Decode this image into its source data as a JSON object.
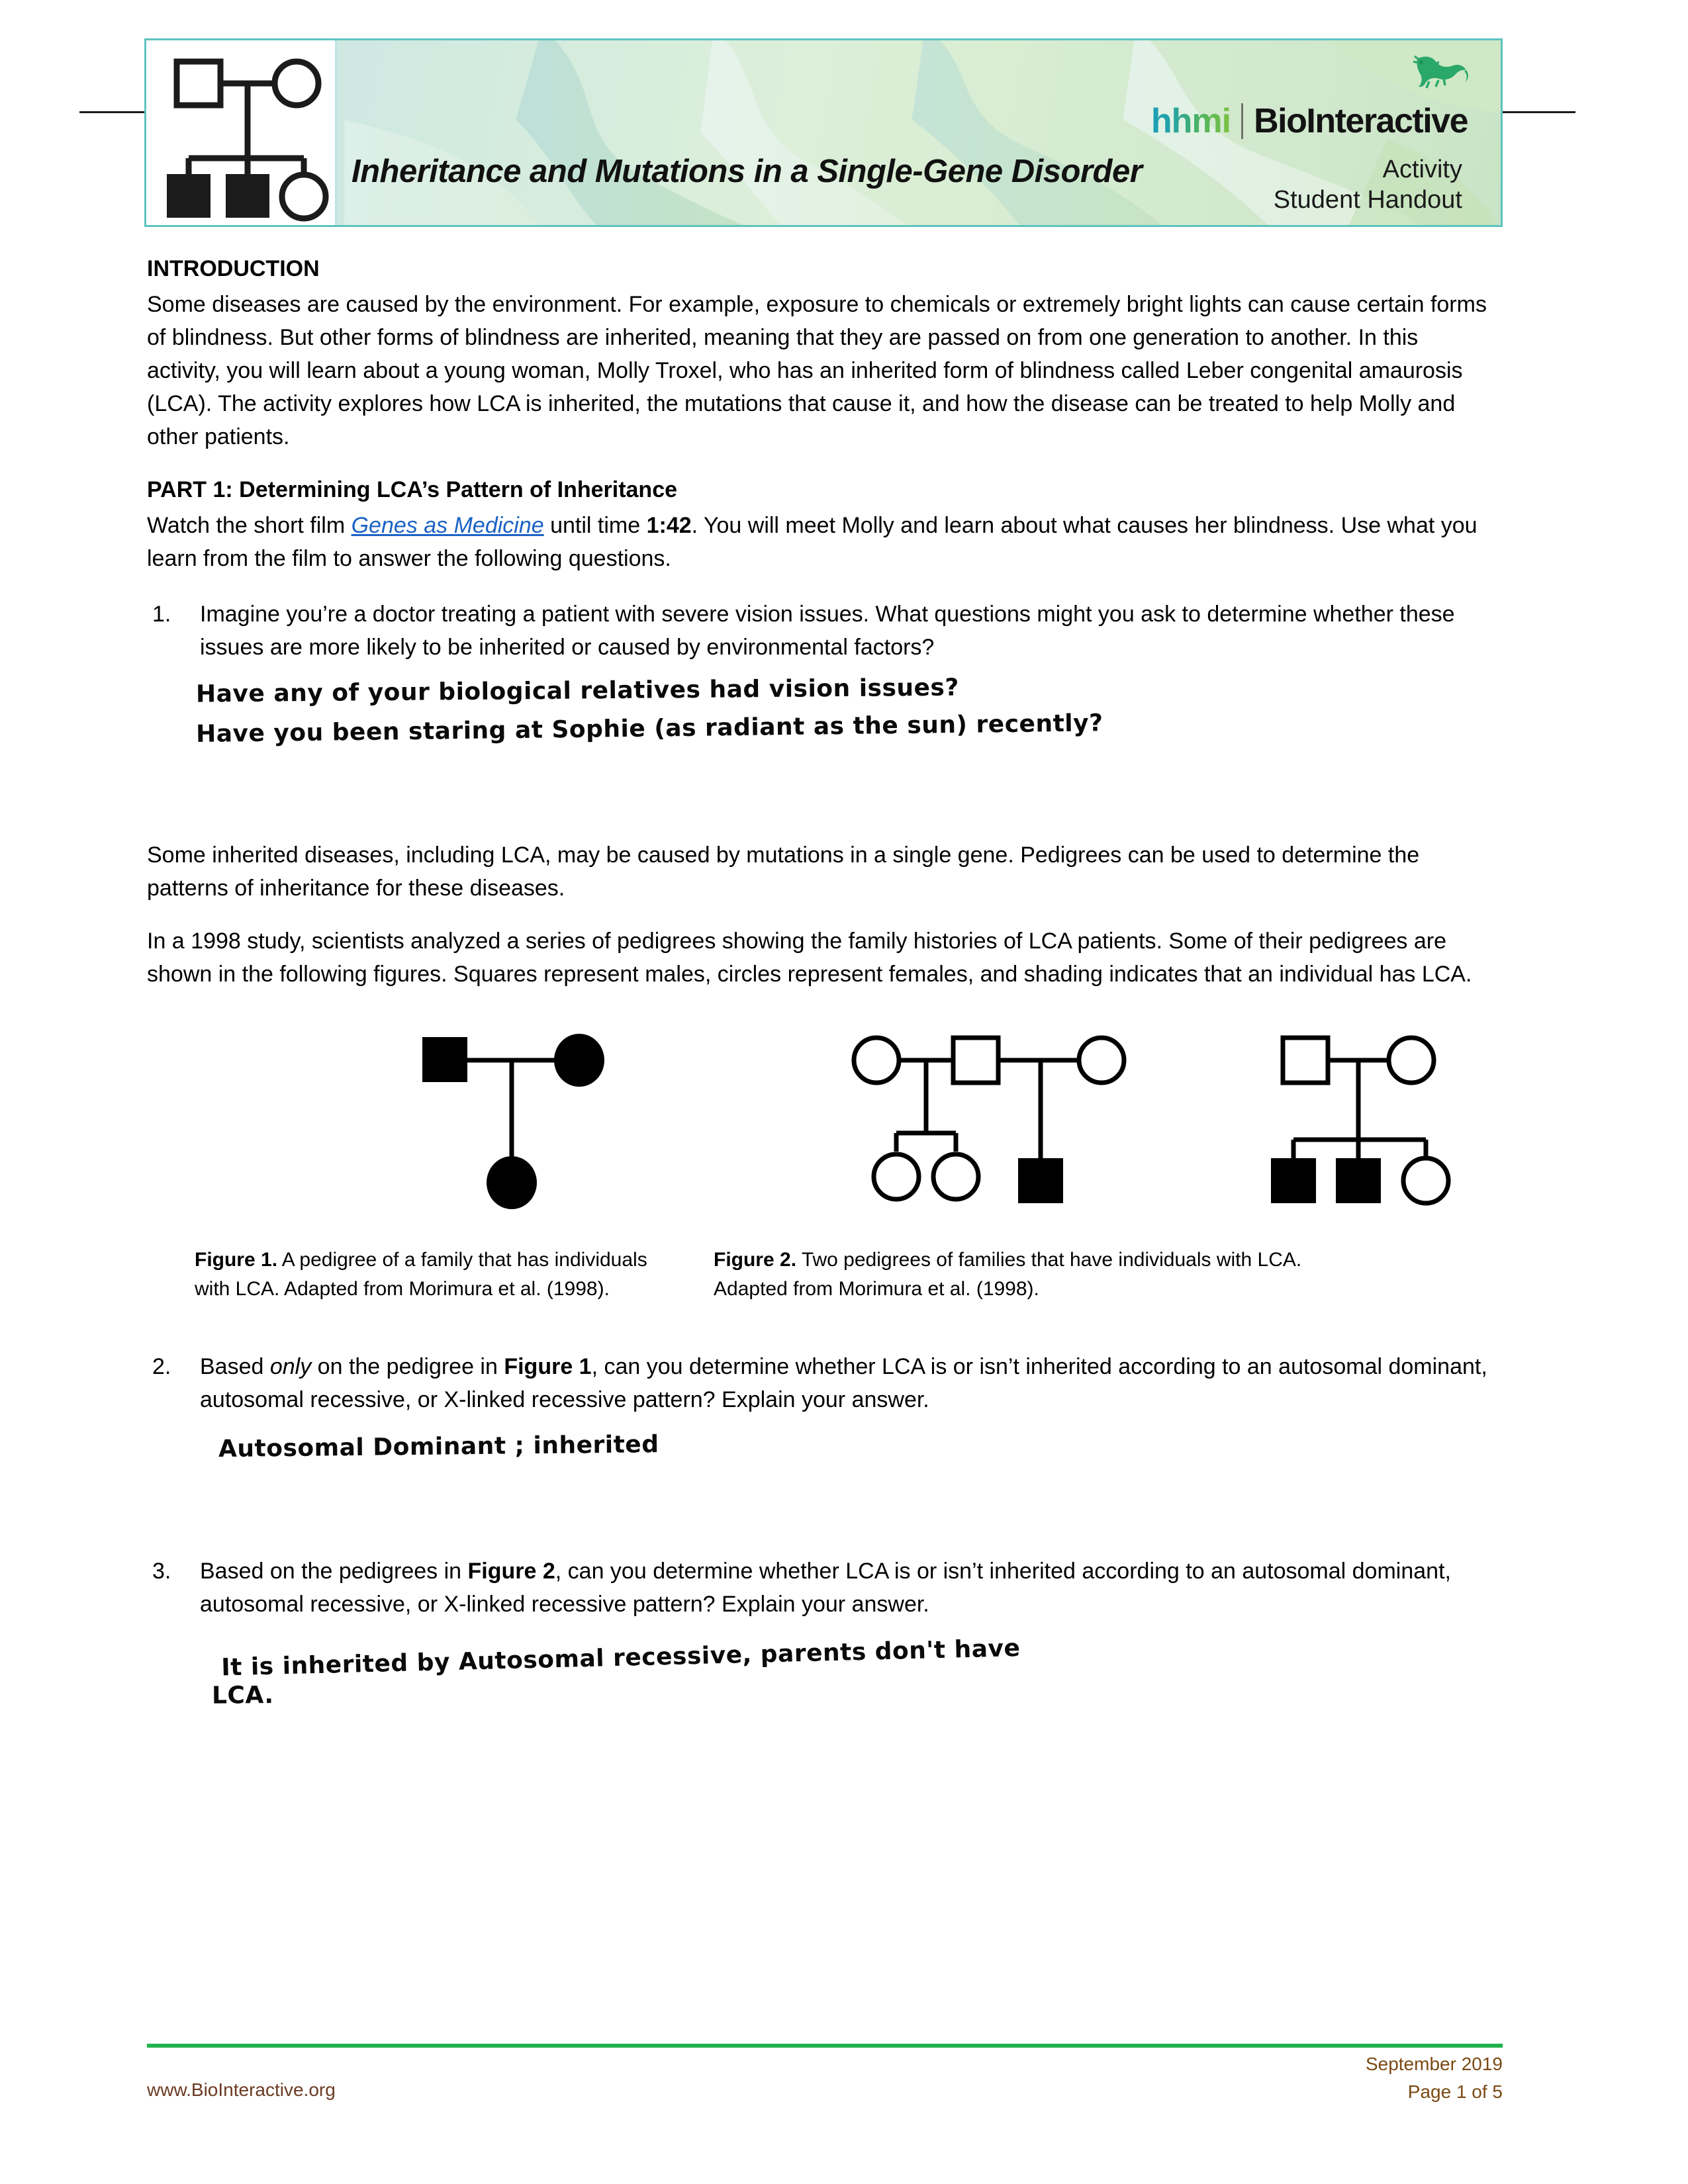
{
  "header": {
    "title": "Inheritance and Mutations in a Single-Gene Disorder",
    "brand_hhmi": "hhmi",
    "brand_bio": "BioInteractive",
    "doc_type": "Activity",
    "doc_audience": "Student Handout",
    "accent_teal": "#5ec3c0",
    "accent_green": "#7ec242",
    "logo_icon": "pedigree-chart-icon",
    "gecko_icon": "gecko-icon"
  },
  "intro": {
    "heading": "INTRODUCTION",
    "paragraph": "Some diseases are caused by the environment. For example, exposure to chemicals or extremely bright lights can cause certain forms of blindness. But other forms of blindness are inherited, meaning that they are passed on from one generation to another. In this activity, you will learn about a young woman, Molly Troxel, who has an inherited form of blindness called Leber congenital amaurosis (LCA). The activity explores how LCA is inherited, the mutations that cause it, and how the disease can be treated to help Molly and other patients."
  },
  "part1": {
    "heading": "PART 1: Determining LCA’s Pattern of Inheritance",
    "instruction_pre": "Watch the short film ",
    "film_link": "Genes as Medicine",
    "instruction_mid": " until time ",
    "timestamp": "1:42",
    "instruction_post": ". You will meet Molly and learn about what causes her blindness. Use what you learn from the film to answer the following questions."
  },
  "questions": [
    {
      "number": "1.",
      "text": "Imagine you’re a doctor treating a patient with severe vision issues. What questions might you ask to determine whether these issues are more likely to be inherited or caused by environmental factors?",
      "answer_lines": [
        "Have any of your biological relatives had vision issues?",
        "Have you been staring at Sophie (as radiant as the sun) recently?"
      ]
    },
    {
      "number": "2.",
      "text_parts": {
        "a": "Based ",
        "b": "only",
        "c": " on the pedigree in ",
        "d": "Figure 1",
        "e": ", can you determine whether LCA is or isn’t inherited according to an autosomal dominant, autosomal recessive, or X-linked recessive pattern? Explain your answer."
      },
      "answer_lines": [
        "Autosomal Dominant ; inherited"
      ]
    },
    {
      "number": "3.",
      "text_parts": {
        "a": "Based on the pedigrees in ",
        "d": "Figure 2",
        "e": ", can you determine whether LCA is or isn’t inherited according to an autosomal dominant, autosomal recessive, or X-linked recessive pattern? Explain your answer."
      },
      "answer_lines": [
        "It is inherited by Autosomal recessive, parents don't have",
        "LCA."
      ]
    }
  ],
  "body_paragraphs": {
    "p1": "Some inherited diseases, including LCA, may be caused by mutations in a single gene. Pedigrees can be used to determine the patterns of inheritance for these diseases.",
    "p2": "In a 1998 study, scientists analyzed a series of pedigrees showing the family histories of LCA patients. Some of their pedigrees are shown in the following figures. Squares represent males, circles represent females, and shading indicates that an individual has LCA."
  },
  "figures": [
    {
      "label": "Figure 1.",
      "caption": " A pedigree of a family that has individuals with LCA. Adapted from Morimura et al. (1998).",
      "pedigree": {
        "generation1": [
          {
            "shape": "square",
            "affected": true
          },
          {
            "shape": "circle",
            "affected": true
          }
        ],
        "generation2": [
          {
            "shape": "circle",
            "affected": true
          }
        ]
      }
    },
    {
      "label": "Figure 2.",
      "caption": " Two pedigrees of families that have individuals with LCA. Adapted from Morimura et al. (1998).",
      "pedigree_left": {
        "generation1": [
          {
            "shape": "circle",
            "affected": false
          },
          {
            "shape": "square",
            "affected": false
          },
          {
            "shape": "circle",
            "affected": false
          }
        ],
        "generation2_union_a": [
          {
            "shape": "circle",
            "affected": false
          },
          {
            "shape": "circle",
            "affected": false
          }
        ],
        "generation2_union_b": [
          {
            "shape": "square",
            "affected": true
          }
        ]
      },
      "pedigree_right": {
        "generation1": [
          {
            "shape": "square",
            "affected": false
          },
          {
            "shape": "circle",
            "affected": false
          }
        ],
        "generation2": [
          {
            "shape": "square",
            "affected": true
          },
          {
            "shape": "square",
            "affected": true
          },
          {
            "shape": "circle",
            "affected": false
          }
        ]
      }
    }
  ],
  "footer": {
    "website": "www.BioInteractive.org",
    "date": "September 2019",
    "page": "Page 1 of 5",
    "rule_color": "#22b24c",
    "text_color": "#6b3a22"
  }
}
